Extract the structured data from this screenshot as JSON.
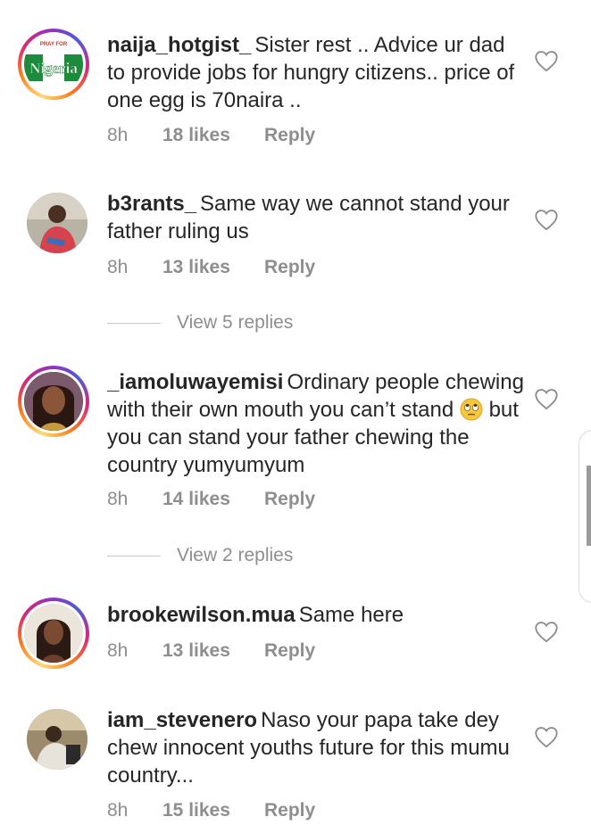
{
  "comments": [
    {
      "username": "naija_hotgist_",
      "text": "Sister rest .. Advice ur dad to provide jobs for hungry citizens.. price of one egg is 70naira ..",
      "time": "8h",
      "likes": "18 likes",
      "reply": "Reply",
      "avatar_icon": "pray-for-nigeria-avatar",
      "avatar_text_top": "PRAY FOR",
      "avatar_text_main": "Nigeria"
    },
    {
      "username": "b3rants_",
      "text": "Same way we cannot stand your father ruling us",
      "time": "8h",
      "likes": "13 likes",
      "reply": "Reply",
      "avatar_icon": "user-photo-avatar"
    },
    {
      "username": "_iamoluwayemisi",
      "text_part1": "Ordinary people chewing with their own mouth you can’t stand",
      "text_part2": "but you can stand your father chewing the country yumyumyum",
      "emoji": "eye-roll-emoji",
      "time": "8h",
      "likes": "14 likes",
      "reply": "Reply",
      "avatar_icon": "user-photo-avatar"
    },
    {
      "username": "brookewilson.mua",
      "text": "Same here",
      "time": "8h",
      "likes": "13 likes",
      "reply": "Reply",
      "avatar_icon": "user-photo-avatar"
    },
    {
      "username": "iam_stevenero",
      "text": "Naso your papa take dey chew innocent youths future for this mumu country...",
      "time": "8h",
      "likes": "15 likes",
      "reply": "Reply",
      "avatar_icon": "user-photo-avatar"
    }
  ],
  "view_replies": [
    {
      "label": "View 5 replies"
    },
    {
      "label": "View 2 replies"
    }
  ],
  "colors": {
    "text": "#262626",
    "secondary": "#8e8e8e",
    "divider": "#c7c7c7",
    "nigeria_green": "#1e8a3c"
  },
  "icons": {
    "like": "heart-outline-icon"
  }
}
